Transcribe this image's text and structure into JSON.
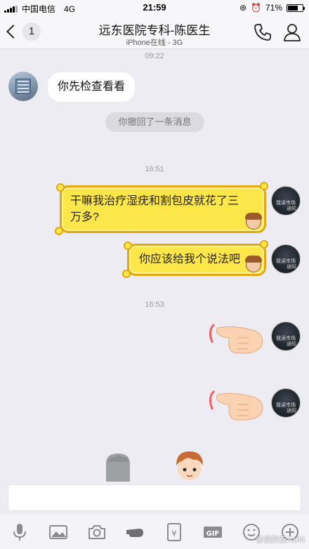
{
  "status_bar": {
    "carrier": "中国电信",
    "network": "4G",
    "time": "21:59",
    "battery": "71%",
    "battery_level": 0.71
  },
  "header": {
    "back_count": "1",
    "title": "远东医院专科-陈医生",
    "subtitle": "iPhone在线 - 3G"
  },
  "messages": {
    "time_1": "09:22",
    "left_text": "你先检查看看",
    "recall_notice": "你撤回了一条消息",
    "time_2": "16:51",
    "right_text_1": "干嘛我治疗湿疣和割包皮就花了三万多?",
    "right_text_2": "你应该给我个说法吧",
    "time_3": "16:53",
    "avatar_text_1": "我读市场",
    "avatar_text_2": "通知"
  },
  "toolbar": {
    "gif_label": "GIF",
    "yen_label": "¥"
  },
  "watermark": "@我的安A134",
  "colors": {
    "bubble_gold": "#fbe74a",
    "bubble_border": "#e3a810",
    "background": "#ececf2"
  },
  "icons": [
    "phone-icon",
    "person-icon",
    "microphone-icon",
    "image-icon",
    "camera-icon",
    "hand-icon",
    "red-packet-icon",
    "gif-icon",
    "emoji-icon",
    "plus-icon"
  ]
}
